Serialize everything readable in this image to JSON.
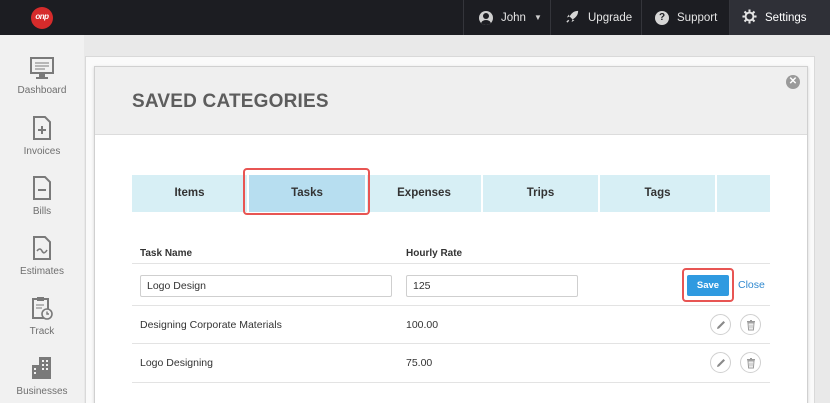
{
  "brand": {
    "logo_text": "onp",
    "accent": "#d62b2b"
  },
  "topbar": {
    "user_label": "John",
    "upgrade_label": "Upgrade",
    "support_label": "Support",
    "settings_label": "Settings"
  },
  "sidebar": {
    "items": [
      {
        "label": "Dashboard",
        "icon": "monitor-icon"
      },
      {
        "label": "Invoices",
        "icon": "invoice-plus-icon"
      },
      {
        "label": "Bills",
        "icon": "bill-icon"
      },
      {
        "label": "Estimates",
        "icon": "estimate-icon"
      },
      {
        "label": "Track",
        "icon": "clipboard-clock-icon"
      },
      {
        "label": "Businesses",
        "icon": "buildings-icon"
      }
    ]
  },
  "modal": {
    "title": "SAVED CATEGORIES",
    "tabs": [
      "Items",
      "Tasks",
      "Expenses",
      "Trips",
      "Tags"
    ],
    "active_tab": "Tasks",
    "columns": {
      "task_name": "Task Name",
      "hourly_rate": "Hourly Rate"
    },
    "edit_row": {
      "task_name_value": "Logo Design",
      "hourly_rate_value": "125",
      "save_label": "Save",
      "close_label": "Close"
    },
    "rows": [
      {
        "task_name": "Designing Corporate Materials",
        "hourly_rate": "100.00"
      },
      {
        "task_name": "Logo Designing",
        "hourly_rate": "75.00"
      }
    ]
  },
  "colors": {
    "topbar_bg": "#1c1d22",
    "tab_bg": "#d7eff5",
    "tab_active_bg": "#b7def0",
    "highlight": "#e85553",
    "save_button": "#2f9ae0",
    "link": "#2f88cf"
  }
}
